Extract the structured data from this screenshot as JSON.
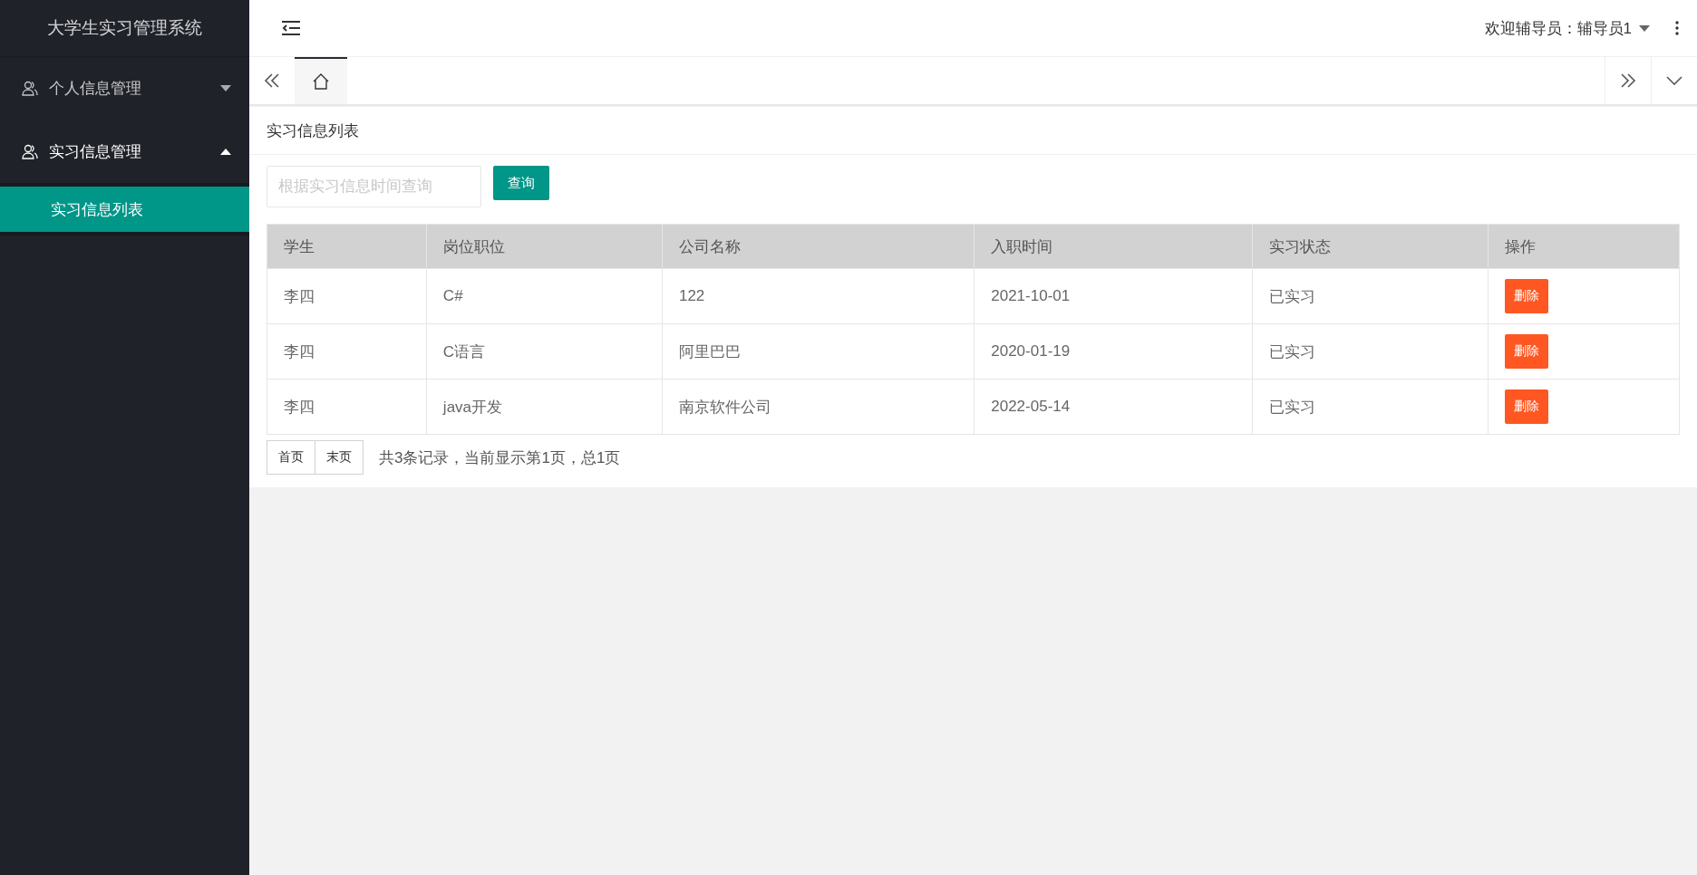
{
  "sidebar": {
    "title": "大学生实习管理系统",
    "menus": [
      {
        "label": "个人信息管理",
        "expanded": false
      },
      {
        "label": "实习信息管理",
        "expanded": true,
        "children": [
          {
            "label": "实习信息列表",
            "selected": true
          }
        ]
      }
    ]
  },
  "header": {
    "user_menu": "欢迎辅导员：辅导员1"
  },
  "tabs": [
    {
      "kind": "home",
      "selected": true
    }
  ],
  "page_title": "实习信息列表",
  "search": {
    "placeholder": "根据实习信息时间查询",
    "button": "查询"
  },
  "table": {
    "columns": [
      "学生",
      "岗位职位",
      "公司名称",
      "入职时间",
      "实习状态",
      "操作"
    ],
    "rows": [
      {
        "cells": [
          "李四",
          "C#",
          "122",
          "2021-10-01",
          "已实习"
        ],
        "action": "删除"
      },
      {
        "cells": [
          "李四",
          "C语言",
          "阿里巴巴",
          "2020-01-19",
          "已实习"
        ],
        "action": "删除"
      },
      {
        "cells": [
          "李四",
          "java开发",
          "南京软件公司",
          "2022-05-14",
          "已实习"
        ],
        "action": "删除"
      }
    ]
  },
  "pagination": {
    "buttons": [
      "首页",
      "末页"
    ],
    "summary": "共3条记录，当前显示第1页，总1页"
  }
}
